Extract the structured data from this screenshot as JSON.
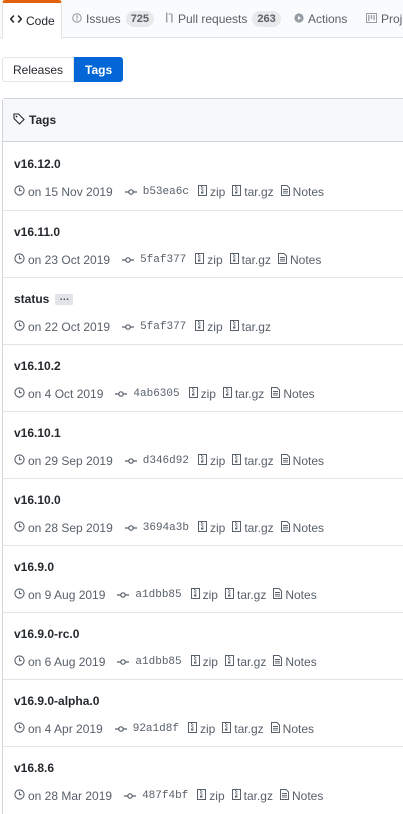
{
  "reponav": {
    "code": "Code",
    "issues": "Issues",
    "issues_count": "725",
    "pulls": "Pull requests",
    "pulls_count": "263",
    "actions": "Actions",
    "projects": "Proj"
  },
  "subnav": {
    "releases": "Releases",
    "tags": "Tags"
  },
  "box": {
    "header": "Tags"
  },
  "tags": [
    {
      "name": "v16.12.0",
      "date": "on 15 Nov 2019",
      "sha": "b53ea6c",
      "zip": "zip",
      "targz": "tar.gz",
      "notes": "Notes"
    },
    {
      "name": "v16.11.0",
      "date": "on 23 Oct 2019",
      "sha": "5faf377",
      "zip": "zip",
      "targz": "tar.gz",
      "notes": "Notes"
    },
    {
      "name": "status",
      "ellipsis": "…",
      "date": "on 22 Oct 2019",
      "sha": "5faf377",
      "zip": "zip",
      "targz": "tar.gz"
    },
    {
      "name": "v16.10.2",
      "date": "on 4 Oct 2019",
      "sha": "4ab6305",
      "zip": "zip",
      "targz": "tar.gz",
      "notes": "Notes"
    },
    {
      "name": "v16.10.1",
      "date": "on 29 Sep 2019",
      "sha": "d346d92",
      "zip": "zip",
      "targz": "tar.gz",
      "notes": "Notes"
    },
    {
      "name": "v16.10.0",
      "date": "on 28 Sep 2019",
      "sha": "3694a3b",
      "zip": "zip",
      "targz": "tar.gz",
      "notes": "Notes"
    },
    {
      "name": "v16.9.0",
      "date": "on 9 Aug 2019",
      "sha": "a1dbb85",
      "zip": "zip",
      "targz": "tar.gz",
      "notes": "Notes"
    },
    {
      "name": "v16.9.0-rc.0",
      "date": "on 6 Aug 2019",
      "sha": "a1dbb85",
      "zip": "zip",
      "targz": "tar.gz",
      "notes": "Notes"
    },
    {
      "name": "v16.9.0-alpha.0",
      "date": "on 4 Apr 2019",
      "sha": "92a1d8f",
      "zip": "zip",
      "targz": "tar.gz",
      "notes": "Notes"
    },
    {
      "name": "v16.8.6",
      "date": "on 28 Mar 2019",
      "sha": "487f4bf",
      "zip": "zip",
      "targz": "tar.gz",
      "notes": "Notes"
    }
  ],
  "icons": {
    "code": "code-icon",
    "issues": "issue-opened-icon",
    "pulls": "git-pull-request-icon",
    "actions": "play-icon",
    "projects": "project-icon",
    "tag": "tag-icon",
    "clock": "clock-icon",
    "commit": "git-commit-icon",
    "zip": "file-zip-icon",
    "notes": "file-icon"
  },
  "colors": {
    "accent": "#0366d6",
    "selected_tab_border": "#e36209",
    "text": "#24292e",
    "muted": "#586069"
  }
}
